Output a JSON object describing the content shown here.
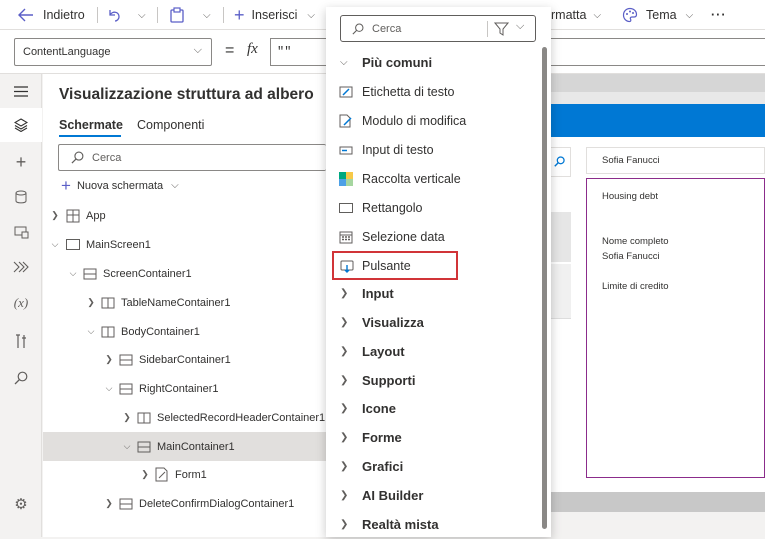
{
  "commandbar": {
    "back_label": "Indietro",
    "insert_label": "Inserisci",
    "format_label": "rmatta",
    "theme_label": "Tema",
    "more_label": "···"
  },
  "formula": {
    "property": "ContentLanguage",
    "equals": "=",
    "fx": "fx",
    "value": "\"\""
  },
  "tree": {
    "title": "Visualizzazione struttura ad albero",
    "tabs": [
      "Schermate",
      "Componenti"
    ],
    "search_placeholder": "Cerca",
    "new_screen_label": "Nuova schermata",
    "nodes": [
      {
        "label": "App"
      },
      {
        "label": "MainScreen1"
      },
      {
        "label": "ScreenContainer1"
      },
      {
        "label": "TableNameContainer1"
      },
      {
        "label": "BodyContainer1"
      },
      {
        "label": "SidebarContainer1"
      },
      {
        "label": "RightContainer1"
      },
      {
        "label": "SelectedRecordHeaderContainer1"
      },
      {
        "label": "MainContainer1"
      },
      {
        "label": "Form1"
      },
      {
        "label": "DeleteConfirmDialogContainer1"
      }
    ]
  },
  "canvas": {
    "header_name": "Sofia Fanucci",
    "field1_label": "Housing debt",
    "field2_label": "Nome completo",
    "field2_value": "Sofia Fanucci",
    "field3_label": "Limite di credito"
  },
  "dropdown": {
    "search_placeholder": "Cerca",
    "common_label": "Più comuni",
    "items": [
      {
        "label": "Etichetta di testo",
        "icon": "text-label-icon"
      },
      {
        "label": "Modulo di modifica",
        "icon": "edit-form-icon"
      },
      {
        "label": "Input di testo",
        "icon": "text-input-icon"
      },
      {
        "label": "Raccolta verticale",
        "icon": "gallery-icon"
      },
      {
        "label": "Rettangolo",
        "icon": "rectangle-icon"
      },
      {
        "label": "Selezione data",
        "icon": "calendar-icon"
      },
      {
        "label": "Pulsante",
        "icon": "button-icon"
      }
    ],
    "categories": [
      "Input",
      "Visualizza",
      "Layout",
      "Supporti",
      "Icone",
      "Forme",
      "Grafici",
      "AI Builder",
      "Realtà mista"
    ]
  },
  "colors": {
    "accent": "#0078d4",
    "highlight_border": "#d13438",
    "form_border": "#8b2c8b"
  }
}
